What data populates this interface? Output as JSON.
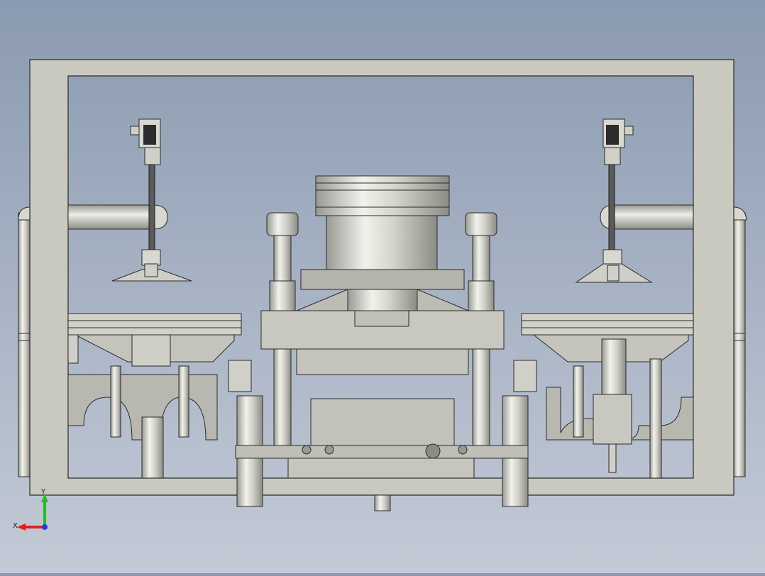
{
  "viewport": {
    "background_top": "#8a9ab0",
    "background_bottom": "#c3cad6",
    "model_fill": "#c8c8c0",
    "model_edge": "#2a2a2a"
  },
  "triad": {
    "x_label": "X",
    "y_label": "Y",
    "x_color": "#e02020",
    "y_color": "#20c020",
    "z_color": "#2040e0"
  }
}
